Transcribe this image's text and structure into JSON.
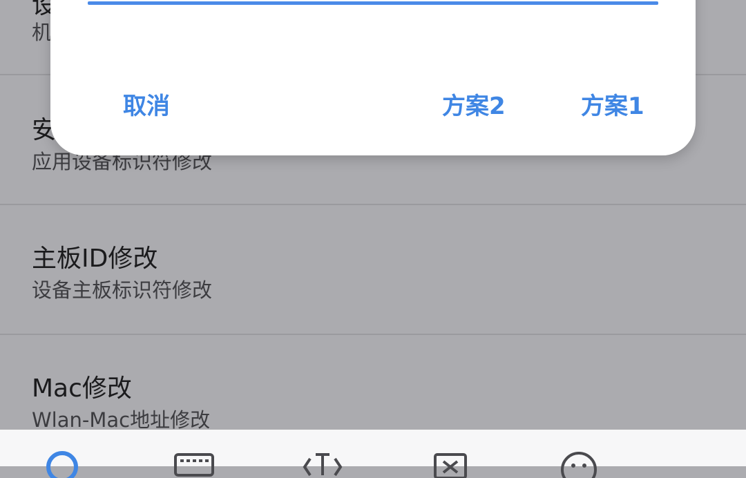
{
  "list": {
    "items": [
      {
        "title": "设",
        "subtitle": "机"
      },
      {
        "title": "安",
        "subtitle": "应用设备标识符修改"
      },
      {
        "title": "主板ID修改",
        "subtitle": "设备主板标识符修改"
      },
      {
        "title": "Mac修改",
        "subtitle": "Wlan-Mac地址修改"
      }
    ]
  },
  "dialog": {
    "cancel_label": "取消",
    "option2_label": "方案2",
    "option1_label": "方案1"
  },
  "bottom_bar": {
    "icons": [
      "search-icon",
      "keyboard-icon",
      "text-cursor-icon",
      "clipboard-icon",
      "emoji-icon"
    ]
  },
  "colors": {
    "accent": "#3f86e4",
    "overlay_background": "#ababaf"
  }
}
